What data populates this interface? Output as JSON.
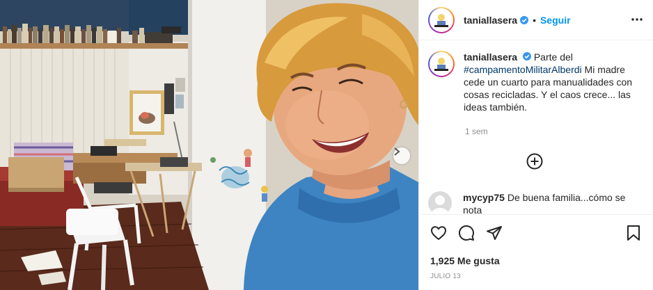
{
  "post": {
    "username": "taniallasera",
    "follow_label": "Seguir",
    "dot": "•",
    "caption_pre": "Parte del",
    "hashtag": "#campamentoMilitarAlberdi",
    "caption_post": "Mi madre cede un cuarto para manualidades con cosas recicladas. Y el caos crece... las ideas también.",
    "time_ago": "1 sem",
    "likes": "1,925 Me gusta",
    "date": "JULIO 13"
  },
  "comments": [
    {
      "username": "mycyp75",
      "text": "De buena familia...cómo se nota"
    }
  ],
  "icons": {
    "verified": "verified-badge-icon",
    "more": "more-options-icon",
    "next": "chevron-right-icon",
    "load_more": "plus-circle-icon",
    "like": "heart-icon",
    "comment": "comment-icon",
    "share": "paper-plane-icon",
    "save": "bookmark-icon"
  },
  "colors": {
    "accent": "#0095f6",
    "hashtag": "#00376b",
    "muted": "#8e8e8e",
    "verified": "#3897f0"
  }
}
